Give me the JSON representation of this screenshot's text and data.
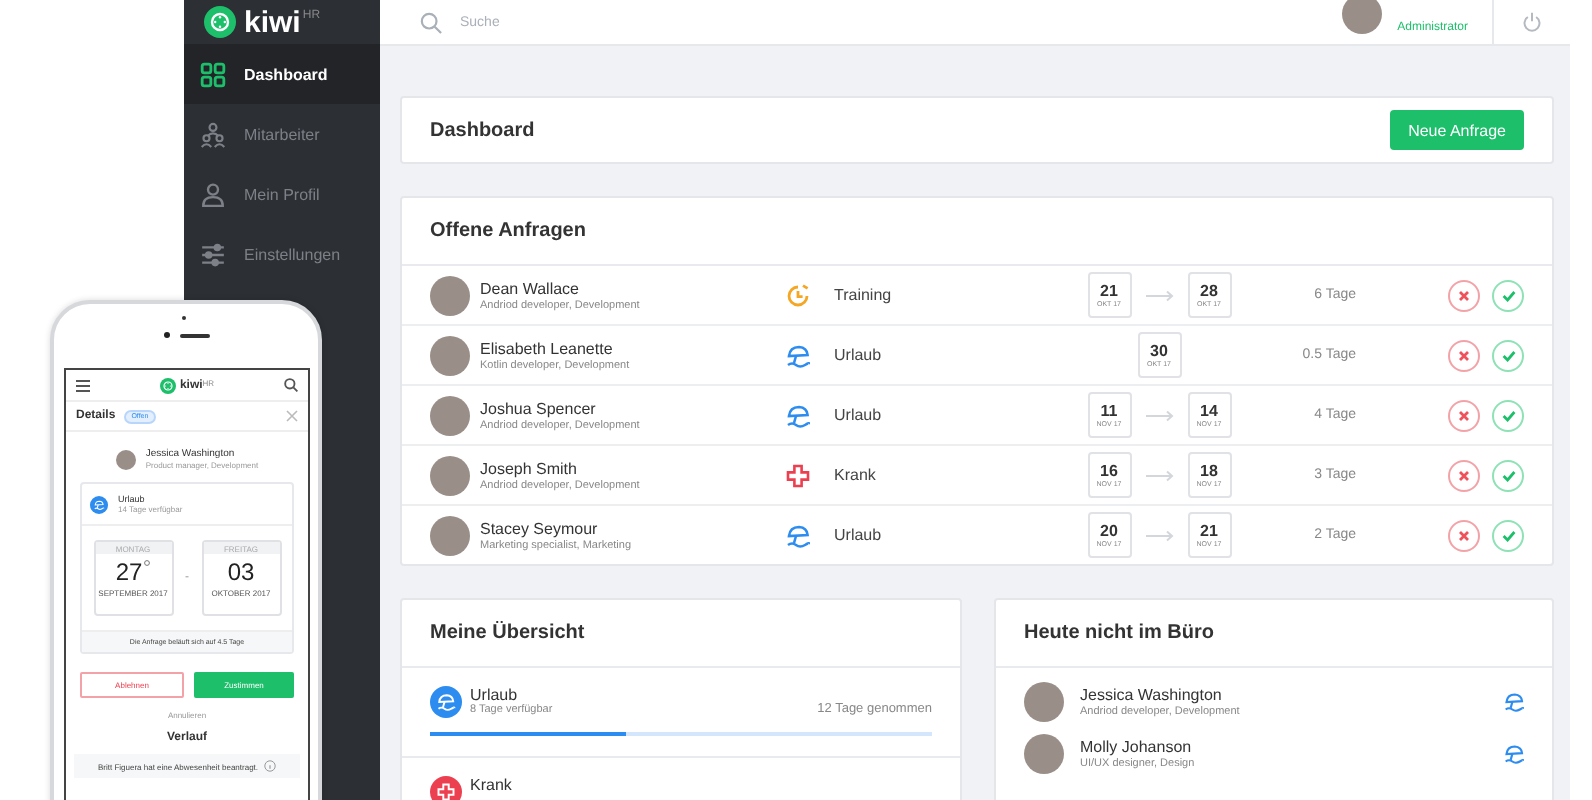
{
  "app": {
    "logo": "kiwi",
    "logo_sup": "HR"
  },
  "sidebar": {
    "items": [
      {
        "label": "Dashboard",
        "kind": "dashboard",
        "selected": true
      },
      {
        "label": "Mitarbeiter",
        "kind": "employees",
        "selected": false
      },
      {
        "label": "Mein Profil",
        "kind": "profile",
        "selected": false
      },
      {
        "label": "Einstellungen",
        "kind": "settings",
        "selected": false
      }
    ]
  },
  "topbar": {
    "search": {
      "placeholder": "Suche"
    },
    "user": {
      "role": "Administrator"
    }
  },
  "header": {
    "title": "Dashboard",
    "button": "Neue Anfrage"
  },
  "requests": {
    "title": "Offene Anfragen",
    "rows": [
      {
        "name": "Dean Wallace",
        "role": "Andriod developer, Development",
        "kind": "training",
        "type": "Training",
        "from": {
          "day": "21",
          "month": "OKT 17"
        },
        "to": {
          "day": "28",
          "month": "OKT 17"
        },
        "duration": "6 Tage"
      },
      {
        "name": "Elisabeth Leanette",
        "role": "Kotlin developer, Development",
        "kind": "vacation",
        "type": "Urlaub",
        "from": {
          "day": "30",
          "month": "OKT 17"
        },
        "duration": "0.5 Tage"
      },
      {
        "name": "Joshua Spencer",
        "role": "Andriod developer, Development",
        "kind": "vacation",
        "type": "Urlaub",
        "from": {
          "day": "11",
          "month": "NOV 17"
        },
        "to": {
          "day": "14",
          "month": "NOV 17"
        },
        "duration": "4 Tage"
      },
      {
        "name": "Joseph Smith",
        "role": "Andriod developer, Development",
        "kind": "sick",
        "type": "Krank",
        "from": {
          "day": "16",
          "month": "NOV 17"
        },
        "to": {
          "day": "18",
          "month": "NOV 17"
        },
        "duration": "3 Tage"
      },
      {
        "name": "Stacey Seymour",
        "role": "Marketing specialist, Marketing",
        "kind": "vacation",
        "type": "Urlaub",
        "from": {
          "day": "20",
          "month": "NOV 17"
        },
        "to": {
          "day": "21",
          "month": "NOV 17"
        },
        "duration": "2 Tage"
      }
    ]
  },
  "overview": {
    "title": "Meine Übersicht",
    "items": [
      {
        "kind": "vacation",
        "label": "Urlaub",
        "sub": "8 Tage verfügbar",
        "taken": "12 Tage genommen",
        "level": 0.39
      },
      {
        "kind": "sick",
        "label": "Krank"
      }
    ]
  },
  "absent": {
    "title": "Heute nicht im Büro",
    "people": [
      {
        "name": "Jessica Washington",
        "role": "Andriod developer, Development",
        "kind": "vacation"
      },
      {
        "name": "Molly Johanson",
        "role": "UI/UX designer, Design",
        "kind": "vacation"
      }
    ]
  },
  "phone": {
    "logo": "kiwi",
    "logo_sup": "HR",
    "title": "Details",
    "status": "Offen",
    "person": {
      "name": "Jessica Washington",
      "role": "Product manager, Development"
    },
    "request": {
      "kind": "vacation",
      "label": "Urlaub",
      "sub": "14 Tage verfügbar",
      "from": {
        "weekday": "MONTAG",
        "day": "27",
        "month": "SEPTEMBER 2017"
      },
      "separator": "-",
      "to": {
        "weekday": "FREITAG",
        "day": "03",
        "month": "OKTOBER 2017"
      },
      "summary": "Die Anfrage beläuft sich auf 4.5 Tage"
    },
    "buttons": [
      {
        "kind": "reject",
        "label": "Ablehnen"
      },
      {
        "kind": "approve",
        "label": "Zustimmen"
      }
    ],
    "cancel": "Annulieren",
    "history_title": "Verlauf",
    "history": [
      {
        "text": "Britt Figuera hat eine Abwesenheit beantragt."
      }
    ]
  }
}
